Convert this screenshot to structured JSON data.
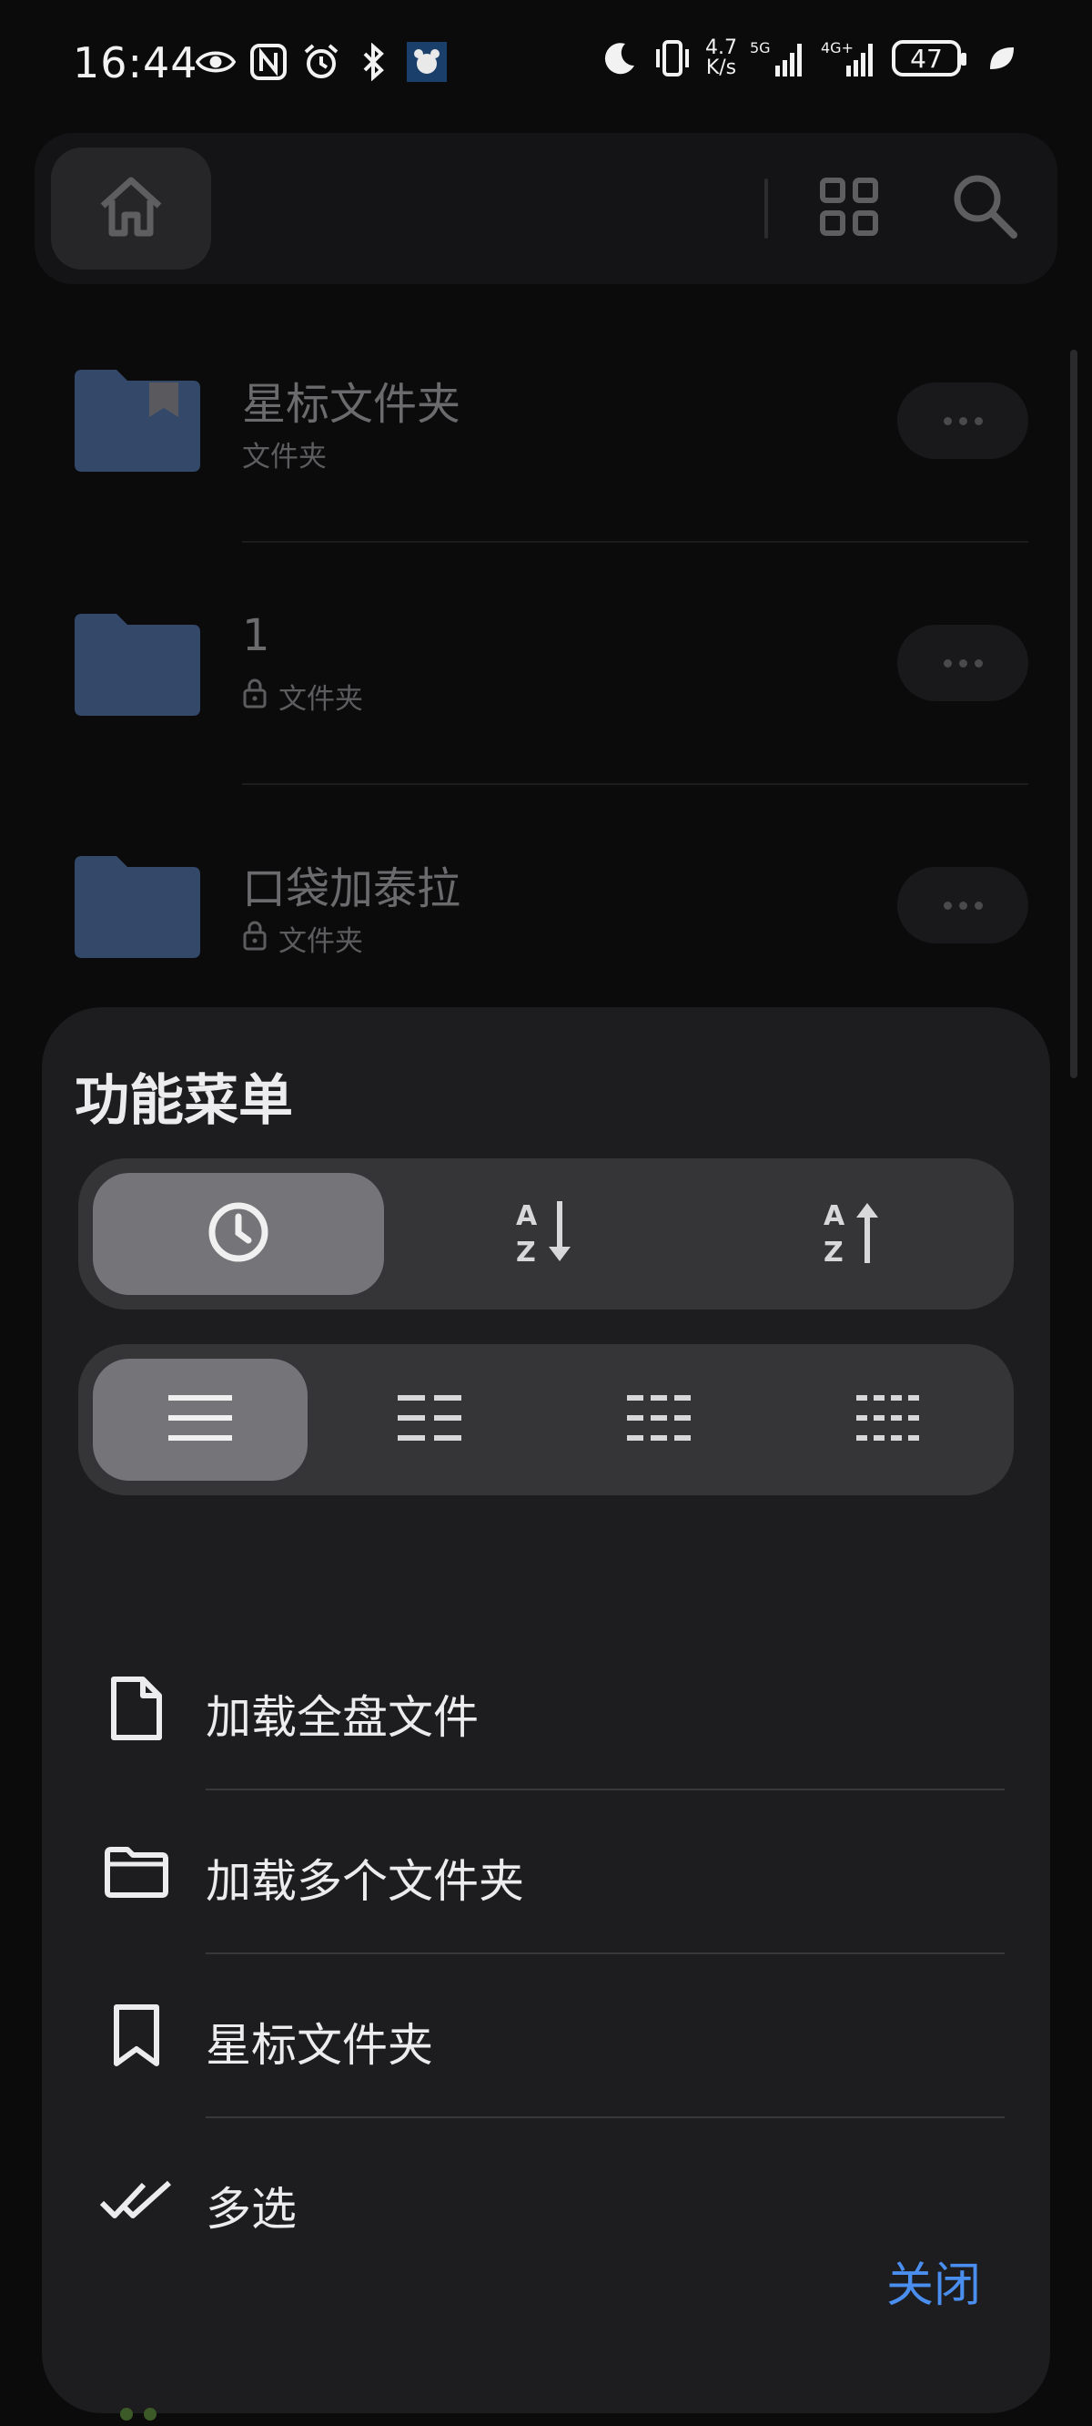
{
  "status_bar": {
    "time": "16:44",
    "network_speed_top": "4.7",
    "network_speed_bottom": "K/s",
    "signal_1_label": "5G",
    "signal_2_label": "4G+",
    "battery": "47",
    "left_icons": [
      "eye-icon",
      "nfc-icon",
      "alarm-icon",
      "bluetooth-icon",
      "app-notification-icon"
    ],
    "right_icons": [
      "moon-icon",
      "vibrate-icon",
      "signal-icon",
      "signal-icon",
      "battery-icon",
      "leaf-icon"
    ]
  },
  "toolbar": {
    "icons": [
      "home-icon",
      "grid-view-icon",
      "search-icon"
    ]
  },
  "files": [
    {
      "name": "星标文件夹",
      "meta": "文件夹",
      "locked": false,
      "bookmarked": true
    },
    {
      "name": "1",
      "meta": "文件夹",
      "locked": true,
      "bookmarked": false
    },
    {
      "name": "口袋加泰拉",
      "meta": "文件夹",
      "locked": true,
      "bookmarked": false
    }
  ],
  "sheet": {
    "title": "功能菜单",
    "sort_options": [
      {
        "icon": "clock-icon",
        "active": true
      },
      {
        "icon": "sort-az-descending-icon",
        "active": false
      },
      {
        "icon": "sort-az-ascending-icon",
        "active": false
      }
    ],
    "view_options": [
      {
        "icon": "list-1-column-icon",
        "active": true
      },
      {
        "icon": "list-2-column-icon",
        "active": false
      },
      {
        "icon": "list-3-column-icon",
        "active": false
      },
      {
        "icon": "list-4-column-icon",
        "active": false
      }
    ],
    "menu_items": [
      {
        "label": "加载全盘文件",
        "icon": "file-icon"
      },
      {
        "label": "加载多个文件夹",
        "icon": "folder-outline-icon"
      },
      {
        "label": "星标文件夹",
        "icon": "bookmark-icon"
      },
      {
        "label": "多选",
        "icon": "double-check-icon"
      }
    ],
    "close_label": "关闭"
  },
  "colors": {
    "background": "#0b0b0c",
    "sheet": "#1d1d1f",
    "accent": "#4a8ff0",
    "folder": "#34486a"
  }
}
